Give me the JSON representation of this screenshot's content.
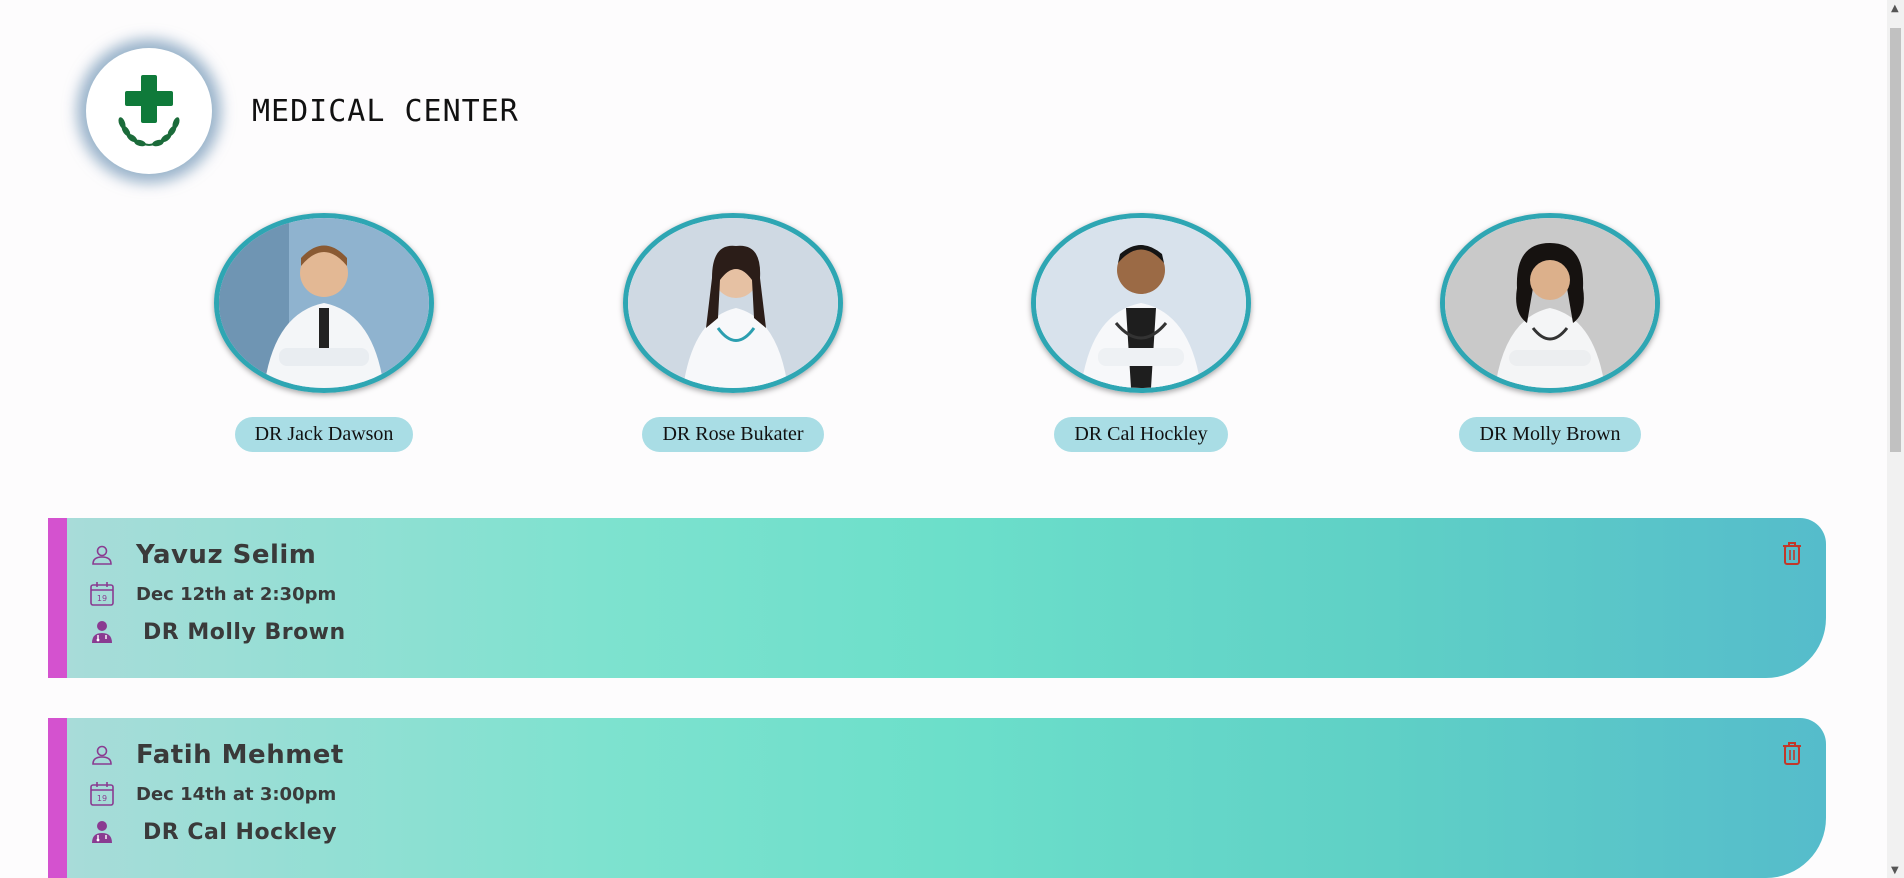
{
  "header": {
    "title": "MEDICAL CENTER",
    "logo_icon": "medical-cross-laurel-icon"
  },
  "doctors": [
    {
      "name": "DR Jack Dawson"
    },
    {
      "name": "DR Rose Bukater"
    },
    {
      "name": "DR Cal Hockley"
    },
    {
      "name": "DR Molly Brown"
    }
  ],
  "appointments": [
    {
      "patient": "Yavuz Selim",
      "when": "Dec 12th at 2:30pm",
      "doctor": "DR Molly Brown",
      "calendar_day": "19"
    },
    {
      "patient": "Fatih Mehmet",
      "when": "Dec 14th at 3:00pm",
      "doctor": "DR Cal Hockley",
      "calendar_day": "19"
    }
  ],
  "colors": {
    "accent": "#d452cf",
    "photo_border": "#2ea6b3",
    "name_pill": "#a9dde5",
    "icon_purple": "#8a3b91",
    "delete": "#c0392b",
    "logo_green": "#0f7a3a"
  }
}
